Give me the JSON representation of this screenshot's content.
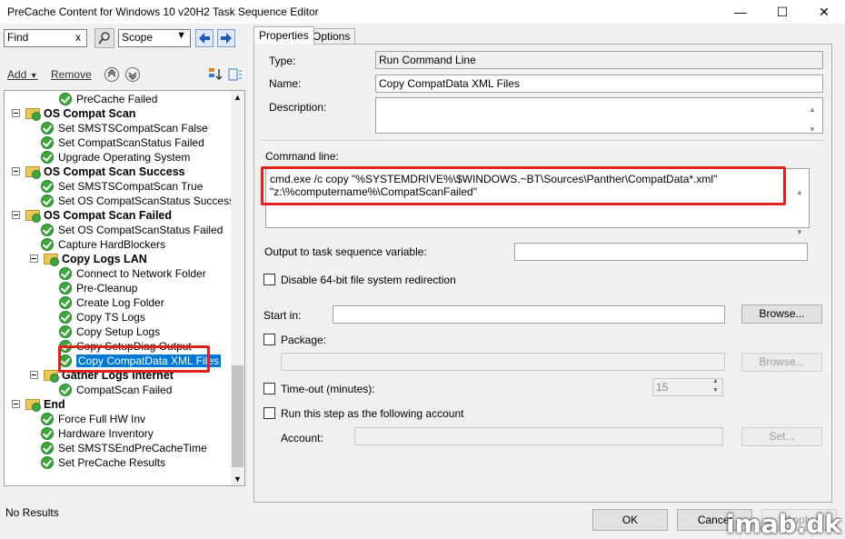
{
  "window": {
    "title": "PreCache Content for Windows 10 v20H2 Task Sequence Editor",
    "minimize": "—",
    "maximize": "☐",
    "close": "✕"
  },
  "toolbar": {
    "find_value": "Find",
    "find_clear": "x",
    "scope_value": "Scope",
    "add_label": "Add",
    "remove_label": "Remove"
  },
  "tree": {
    "rows": [
      {
        "text": "PreCache Failed",
        "kind": "step"
      },
      {
        "text": "OS Compat Scan",
        "kind": "group"
      },
      {
        "text": "Set SMSTSCompatScan False",
        "kind": "step"
      },
      {
        "text": "Set CompatScanStatus Failed",
        "kind": "step"
      },
      {
        "text": "Upgrade Operating System",
        "kind": "step"
      },
      {
        "text": "OS Compat Scan Success",
        "kind": "group"
      },
      {
        "text": "Set SMSTSCompatScan True",
        "kind": "step"
      },
      {
        "text": "Set OS CompatScanStatus Success",
        "kind": "step"
      },
      {
        "text": "OS Compat Scan Failed",
        "kind": "group"
      },
      {
        "text": "Set OS CompatScanStatus Failed",
        "kind": "step"
      },
      {
        "text": "Capture HardBlockers",
        "kind": "step"
      },
      {
        "text": "Copy Logs LAN",
        "kind": "group"
      },
      {
        "text": "Connect to Network Folder",
        "kind": "step"
      },
      {
        "text": "Pre-Cleanup",
        "kind": "step"
      },
      {
        "text": "Create Log Folder",
        "kind": "step"
      },
      {
        "text": "Copy TS Logs",
        "kind": "step"
      },
      {
        "text": "Copy Setup Logs",
        "kind": "step"
      },
      {
        "text": "Copy SetupDiag Output",
        "kind": "step"
      },
      {
        "text": "Copy CompatData XML Files",
        "kind": "step"
      },
      {
        "text": "Gather Logs Internet",
        "kind": "group"
      },
      {
        "text": "CompatScan Failed",
        "kind": "step"
      },
      {
        "text": "End",
        "kind": "group"
      },
      {
        "text": "Force Full HW Inv",
        "kind": "step"
      },
      {
        "text": "Hardware Inventory",
        "kind": "step"
      },
      {
        "text": "Set SMSTSEndPreCacheTime",
        "kind": "step"
      },
      {
        "text": "Set PreCache Results",
        "kind": "step"
      }
    ]
  },
  "tabs": [
    "Properties",
    "Options"
  ],
  "properties": {
    "type_label": "Type:",
    "type_value": "Run Command Line",
    "name_label": "Name:",
    "name_value": "Copy CompatData XML Files",
    "description_label": "Description:",
    "description_value": "",
    "command_label": "Command line:",
    "command_value": "cmd.exe /c copy \"%SYSTEMDRIVE%\\$WINDOWS.~BT\\Sources\\Panther\\CompatData*.xml\" \"z:\\%computername%\\CompatScanFailed\"",
    "output_label": "Output to task sequence variable:",
    "disable64_label": "Disable 64-bit file system redirection",
    "startin_label": "Start in:",
    "browse_label": "Browse...",
    "package_label": "Package:",
    "browse2_label": "Browse...",
    "timeout_label": "Time-out (minutes):",
    "timeout_value": "15",
    "runas_label": "Run this step as the following account",
    "account_label": "Account:",
    "set_label": "Set..."
  },
  "status": {
    "text": "No Results",
    "ok_label": "OK",
    "cancel_label": "Cancel",
    "apply_label": "Apply"
  },
  "watermark": "imab.dk"
}
